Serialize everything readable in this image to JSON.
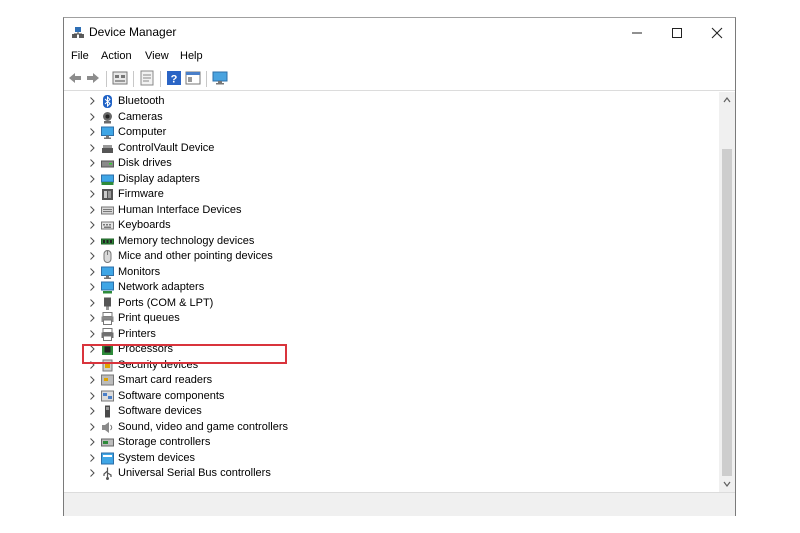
{
  "window": {
    "title": "Device Manager"
  },
  "menu": [
    "File",
    "Action",
    "View",
    "Help"
  ],
  "toolbar_icons": [
    "back-arrow-icon",
    "forward-arrow-icon",
    "device-manager-icon",
    "properties-icon",
    "help-icon",
    "view-icon",
    "monitor-icon"
  ],
  "tree": {
    "items": [
      {
        "label": "Bluetooth",
        "icon": "bluetooth-icon"
      },
      {
        "label": "Cameras",
        "icon": "camera-icon"
      },
      {
        "label": "Computer",
        "icon": "computer-icon"
      },
      {
        "label": "ControlVault Device",
        "icon": "controlvault-icon"
      },
      {
        "label": "Disk drives",
        "icon": "disk-drive-icon"
      },
      {
        "label": "Display adapters",
        "icon": "display-adapter-icon"
      },
      {
        "label": "Firmware",
        "icon": "firmware-icon"
      },
      {
        "label": "Human Interface Devices",
        "icon": "hid-icon"
      },
      {
        "label": "Keyboards",
        "icon": "keyboard-icon"
      },
      {
        "label": "Memory technology devices",
        "icon": "memory-icon"
      },
      {
        "label": "Mice and other pointing devices",
        "icon": "mouse-icon"
      },
      {
        "label": "Monitors",
        "icon": "monitor-icon"
      },
      {
        "label": "Network adapters",
        "icon": "network-adapter-icon"
      },
      {
        "label": "Ports (COM & LPT)",
        "icon": "port-icon"
      },
      {
        "label": "Print queues",
        "icon": "print-queue-icon"
      },
      {
        "label": "Printers",
        "icon": "printer-icon"
      },
      {
        "label": "Processors",
        "icon": "processor-icon"
      },
      {
        "label": "Security devices",
        "icon": "security-icon"
      },
      {
        "label": "Smart card readers",
        "icon": "smart-card-icon"
      },
      {
        "label": "Software components",
        "icon": "software-component-icon"
      },
      {
        "label": "Software devices",
        "icon": "software-device-icon"
      },
      {
        "label": "Sound, video and game controllers",
        "icon": "sound-icon"
      },
      {
        "label": "Storage controllers",
        "icon": "storage-icon"
      },
      {
        "label": "System devices",
        "icon": "system-icon"
      },
      {
        "label": "Universal Serial Bus controllers",
        "icon": "usb-icon"
      }
    ],
    "highlighted": "Sound, video and game controllers"
  },
  "colors": {
    "highlight_border": "#d9343c",
    "accent_blue": "#1f7fd1"
  }
}
